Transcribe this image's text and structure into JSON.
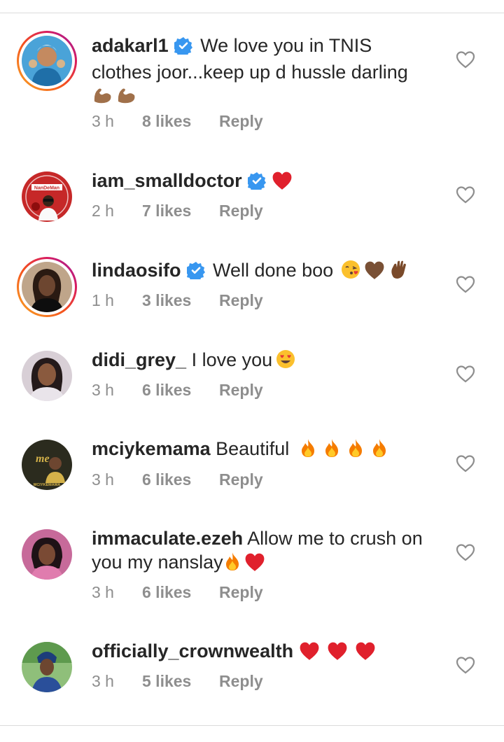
{
  "comments": [
    {
      "username": "adakarl1",
      "verified": true,
      "ring": true,
      "text_lines": [
        "We love you in TNIS",
        "clothes joor...keep up d hussle darling"
      ],
      "emojis": [
        "flexed-biceps",
        "flexed-biceps"
      ],
      "time": "3 h",
      "likes": "8 likes",
      "reply": "Reply",
      "avatar_color": "#3a8fc8"
    },
    {
      "username": "iam_smalldoctor",
      "verified": true,
      "ring": false,
      "text": "",
      "emojis": [
        "red-heart"
      ],
      "time": "2 h",
      "likes": "7 likes",
      "reply": "Reply",
      "avatar_color": "#c62828",
      "avatar_label": "NanDeMan"
    },
    {
      "username": "lindaosifo",
      "verified": true,
      "ring": true,
      "text": "Well done boo",
      "emojis": [
        "face-blowing-kiss",
        "brown-heart",
        "waving-hand"
      ],
      "time": "1 h",
      "likes": "3 likes",
      "reply": "Reply",
      "avatar_color": "#6d4c41"
    },
    {
      "username": "didi_grey_",
      "verified": false,
      "ring": false,
      "text": "I love you",
      "emojis": [
        "heart-eyes"
      ],
      "time": "3 h",
      "likes": "6 likes",
      "reply": "Reply",
      "avatar_color": "#8e7a8a"
    },
    {
      "username": "mciykemama",
      "verified": false,
      "ring": false,
      "text": "Beautiful",
      "emojis": [
        "fire",
        "fire",
        "fire",
        "fire"
      ],
      "time": "3 h",
      "likes": "6 likes",
      "reply": "Reply",
      "avatar_color": "#2b2b1e",
      "avatar_label": "MCIYKEMAMA"
    },
    {
      "username": "immaculate.ezeh",
      "verified": false,
      "ring": false,
      "text_lines": [
        "Allow me to crush on",
        "you my nanslay"
      ],
      "emojis": [
        "fire",
        "red-heart"
      ],
      "time": "3 h",
      "likes": "6 likes",
      "reply": "Reply",
      "avatar_color": "#b85a8a"
    },
    {
      "username": "officially_crownwealth",
      "verified": false,
      "ring": false,
      "text": "",
      "emojis": [
        "red-heart",
        "red-heart",
        "red-heart"
      ],
      "time": "3 h",
      "likes": "5 likes",
      "reply": "Reply",
      "avatar_color": "#3f7a3a"
    }
  ],
  "icons": {
    "like": "heart-outline-icon",
    "verified": "verified-badge-icon"
  },
  "colors": {
    "verified": "#3897f0",
    "muted": "#8e8e8e",
    "heart": "#e0202c"
  }
}
